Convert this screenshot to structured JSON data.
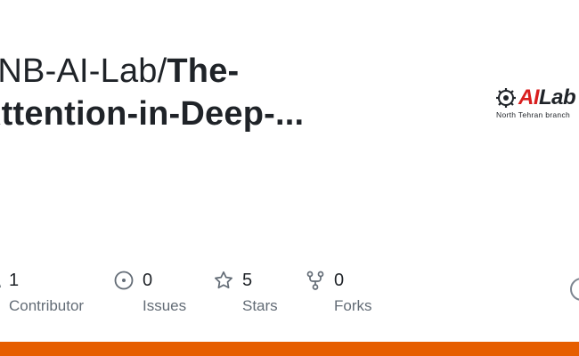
{
  "repo": {
    "owner": "TNB-AI-Lab/",
    "name_line1": "The-",
    "name_line2": "Attention-in-Deep-..."
  },
  "logo": {
    "brand_ai": "AI",
    "brand_lab": "Lab",
    "subtitle": "North Tehran branch"
  },
  "stats": [
    {
      "icon": "people-icon",
      "value": "1",
      "label": "Contributor"
    },
    {
      "icon": "issue-icon",
      "value": "0",
      "label": "Issues"
    },
    {
      "icon": "star-icon",
      "value": "5",
      "label": "Stars"
    },
    {
      "icon": "fork-icon",
      "value": "0",
      "label": "Forks"
    }
  ],
  "colors": {
    "accent_bar": "#e65e00",
    "logo_red": "#d91e1e",
    "muted_text": "#636c76"
  }
}
